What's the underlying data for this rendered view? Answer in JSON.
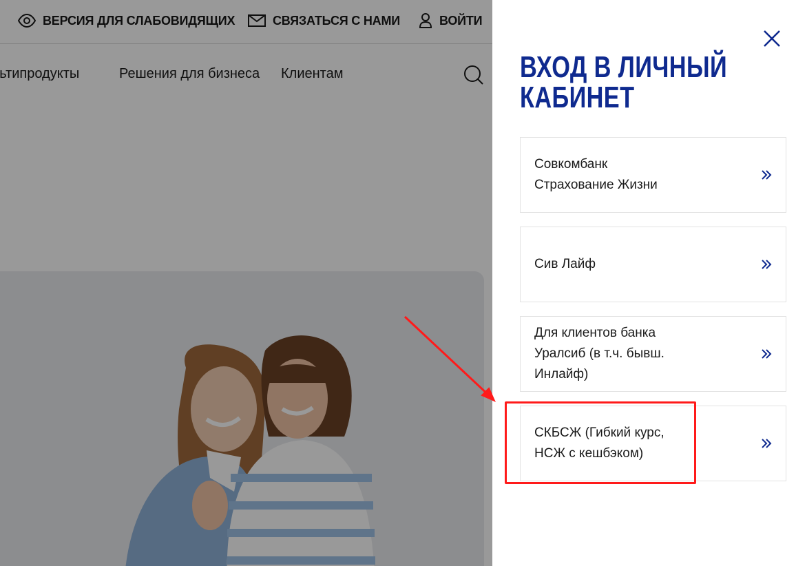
{
  "topbar": {
    "accessibility_label": "ВЕРСИЯ ДЛЯ СЛАБОВИДЯЩИХ",
    "contact_label": "СВЯЗАТЬСЯ С НАМИ",
    "login_label": "ВОЙТИ"
  },
  "nav": {
    "items": [
      {
        "label": "ультипродукты"
      },
      {
        "label": "Решения для бизнеса"
      },
      {
        "label": "Клиентам"
      }
    ]
  },
  "panel": {
    "title": "ВХОД В ЛИЧНЫЙ\nКАБИНЕТ",
    "cards": [
      {
        "label": "Совкомбанк\nСтрахование Жизни"
      },
      {
        "label": "Сив Лайф"
      },
      {
        "label": "Для клиентов банка\nУралсиб (в т.ч. бывш.\nИнлайф)"
      },
      {
        "label": "СКБСЖ (Гибкий курс,\nНСЖ с кешбэком)"
      }
    ]
  },
  "colors": {
    "accent": "#0f2a8f",
    "annotation": "#ff1a1a",
    "overlay": "rgba(0,0,0,0.40)"
  },
  "icons": {
    "accessibility": "eye-icon",
    "contact": "mail-icon",
    "login": "user-icon",
    "search": "search-icon",
    "close": "close-icon",
    "card_arrow": "double-chevron-right-icon"
  }
}
